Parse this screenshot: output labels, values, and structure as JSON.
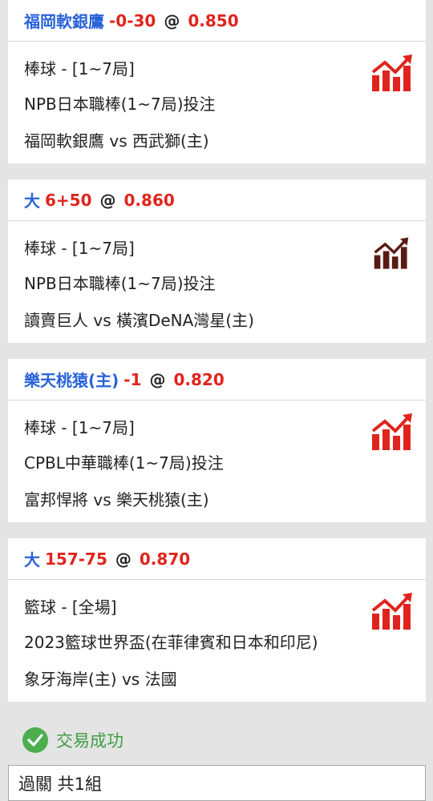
{
  "bets": [
    {
      "selection": "福岡軟銀鷹",
      "handicap": "-0-30",
      "at": "@",
      "odds": "0.850",
      "sport": "棒球 - [1~7局]",
      "league": "NPB日本職棒(1~7局)投注",
      "match": "福岡軟銀鷹 vs 西武獅(主)",
      "icon": "chart-trend-icon",
      "icon_color": "#e0241d"
    },
    {
      "selection": "大",
      "handicap": "6+50",
      "at": "@",
      "odds": "0.860",
      "sport": "棒球 - [1~7局]",
      "league": "NPB日本職棒(1~7局)投注",
      "match": "讀賣巨人 vs 橫濱DeNA灣星(主)",
      "icon": "chart-trend-icon",
      "icon_color": "#5a1a14"
    },
    {
      "selection": "樂天桃猿(主)",
      "handicap": "-1",
      "at": "@",
      "odds": "0.820",
      "sport": "棒球 - [1~7局]",
      "league": "CPBL中華職棒(1~7局)投注",
      "match": "富邦悍將 vs 樂天桃猿(主)",
      "icon": "chart-trend-icon",
      "icon_color": "#e0241d"
    },
    {
      "selection": "大",
      "handicap": "157-75",
      "at": "@",
      "odds": "0.870",
      "sport": "籃球 - [全場]",
      "league": "2023籃球世界盃(在菲律賓和日本和印尼)",
      "match": "象牙海岸(主) vs 法國",
      "icon": "chart-trend-icon",
      "icon_color": "#e0241d"
    }
  ],
  "status": {
    "text": "交易成功",
    "icon": "check-circle-icon",
    "color": "#4cae4f"
  },
  "summary": {
    "text": "過關 共1組"
  }
}
